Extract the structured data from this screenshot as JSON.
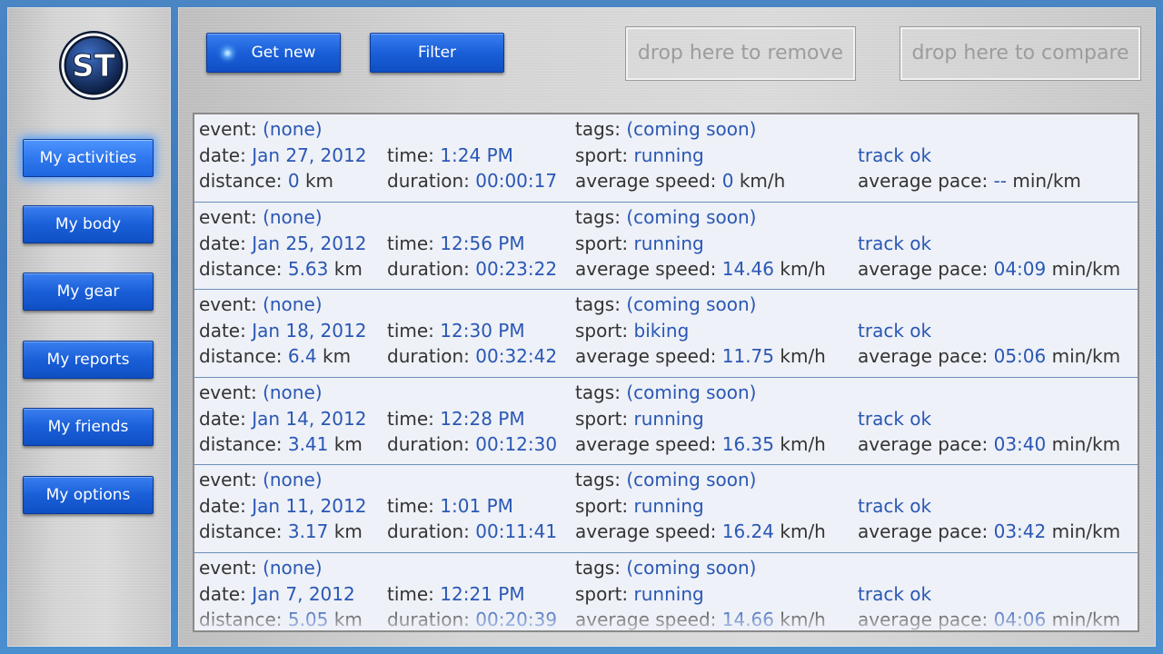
{
  "logo": {
    "text": "ST"
  },
  "sidebar": {
    "items": [
      {
        "label": "My activities",
        "active": true
      },
      {
        "label": "My body"
      },
      {
        "label": "My gear"
      },
      {
        "label": "My reports"
      },
      {
        "label": "My friends"
      },
      {
        "label": "My options"
      }
    ]
  },
  "toolbar": {
    "get_new_label": "Get new",
    "filter_label": "Filter",
    "drop_remove_label": "drop here to remove",
    "drop_compare_label": "drop here to compare"
  },
  "labels": {
    "event": "event:",
    "date": "date:",
    "time": "time:",
    "distance": "distance:",
    "duration": "duration:",
    "tags": "tags:",
    "sport": "sport:",
    "avg_speed": "average speed:",
    "avg_pace": "average pace:",
    "km": "km",
    "kmh": "km/h",
    "minkm": "min/km"
  },
  "activities": [
    {
      "event": "(none)",
      "date": "Jan 27, 2012",
      "time": "1:24 PM",
      "distance": "0",
      "duration": "00:00:17",
      "tags": "(coming soon)",
      "sport": "running",
      "track": "track ok",
      "avg_speed": "0",
      "avg_pace": "--"
    },
    {
      "event": "(none)",
      "date": "Jan 25, 2012",
      "time": "12:56 PM",
      "distance": "5.63",
      "duration": "00:23:22",
      "tags": "(coming soon)",
      "sport": "running",
      "track": "track ok",
      "avg_speed": "14.46",
      "avg_pace": "04:09"
    },
    {
      "event": "(none)",
      "date": "Jan 18, 2012",
      "time": "12:30 PM",
      "distance": "6.4",
      "duration": "00:32:42",
      "tags": "(coming soon)",
      "sport": "biking",
      "track": "track ok",
      "avg_speed": "11.75",
      "avg_pace": "05:06"
    },
    {
      "event": "(none)",
      "date": "Jan 14, 2012",
      "time": "12:28 PM",
      "distance": "3.41",
      "duration": "00:12:30",
      "tags": "(coming soon)",
      "sport": "running",
      "track": "track ok",
      "avg_speed": "16.35",
      "avg_pace": "03:40"
    },
    {
      "event": "(none)",
      "date": "Jan 11, 2012",
      "time": "1:01 PM",
      "distance": "3.17",
      "duration": "00:11:41",
      "tags": "(coming soon)",
      "sport": "running",
      "track": "track ok",
      "avg_speed": "16.24",
      "avg_pace": "03:42"
    },
    {
      "event": "(none)",
      "date": "Jan 7, 2012",
      "time": "12:21 PM",
      "distance": "5.05",
      "duration": "00:20:39",
      "tags": "(coming soon)",
      "sport": "running",
      "track": "track ok",
      "avg_speed": "14.66",
      "avg_pace": "04:06"
    }
  ]
}
